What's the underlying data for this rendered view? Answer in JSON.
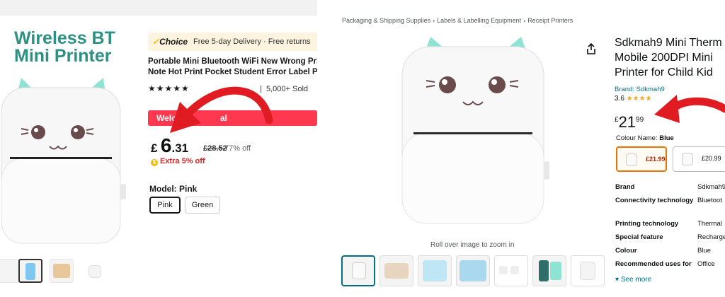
{
  "left": {
    "hero_title_line1": "Wireless BT",
    "hero_title_line2": "Mini Printer",
    "choice_label": "Choice",
    "delivery_text": "Free 5-day Delivery · Free returns",
    "title_line1": "Portable Mini Bluetooth WiFi New Wrong Prin",
    "title_line2": "Note Hot Print Pocket Student Error Label Prin",
    "stars": "★★★★★",
    "sold": "5,000+ Sold",
    "welcome_text": "Welc",
    "welcome_text_tail": "al",
    "price_currency": "£",
    "price_whole": "6",
    "price_fraction": ".31",
    "old_price": "£28.52",
    "discount": "77% off",
    "extra_off": "Extra 5% off",
    "model_label": "Model: Pink",
    "models": [
      "Pink",
      "Green"
    ],
    "selected_model": "Pink"
  },
  "right": {
    "breadcrumbs": [
      "Packaging & Shipping Supplies",
      "Labels & Labelling Equipment",
      "Receipt Printers"
    ],
    "title_line1": "Sdkmah9 Mini Therm",
    "title_line2": "Mobile 200DPI Mini",
    "title_line3": "Printer for Child Kid",
    "brand": "Brand: Sdkmah9",
    "rating": "3.6",
    "rating_stars": "★★★★",
    "price_currency": "£",
    "price_whole": "21",
    "price_fraction": "99",
    "colour_label": "Colour Name:",
    "colour_value": "Blue",
    "swatches": [
      {
        "price": "£21.99"
      },
      {
        "price": "£20.99"
      }
    ],
    "zoom_hint": "Roll over image to zoom in",
    "specs": [
      {
        "key": "Brand",
        "value": "Sdkmah9"
      },
      {
        "key": "Connectivity technology",
        "value": "Bluetoot"
      },
      {
        "key": "Printing technology",
        "value": "Thermal"
      },
      {
        "key": "Special feature",
        "value": "Recharge"
      },
      {
        "key": "Colour",
        "value": "Blue"
      },
      {
        "key": "Recommended uses for",
        "value": "Office"
      }
    ],
    "see_more": "See more"
  },
  "colors": {
    "ali_teal": "#2e8f83",
    "ali_red": "#fd384f",
    "choice_bg": "#fdf4df",
    "amz_link": "#007185",
    "amz_price_red": "#b12704",
    "arrow_red": "#e11b22",
    "mint": "#8fe3d3"
  },
  "icons": [
    "share-icon",
    "star-icon",
    "coin-icon",
    "red-arrow-annotation"
  ]
}
